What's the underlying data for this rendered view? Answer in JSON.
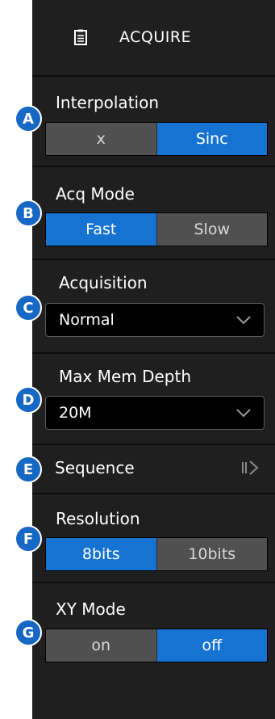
{
  "header": {
    "title": "ACQUIRE",
    "icon": "memo-icon"
  },
  "interpolation": {
    "label": "Interpolation",
    "options": [
      "x",
      "Sinc"
    ],
    "selected": "Sinc"
  },
  "acq_mode": {
    "label": "Acq Mode",
    "options": [
      "Fast",
      "Slow"
    ],
    "selected": "Fast"
  },
  "acquisition": {
    "label": "Acquisition",
    "value": "Normal"
  },
  "max_mem_depth": {
    "label": "Max Mem Depth",
    "value": "20M"
  },
  "sequence": {
    "label": "Sequence"
  },
  "resolution": {
    "label": "Resolution",
    "options": [
      "8bits",
      "10bits"
    ],
    "selected": "8bits"
  },
  "xy_mode": {
    "label": "XY Mode",
    "options": [
      "on",
      "off"
    ],
    "selected": "off"
  },
  "callouts": [
    "A",
    "B",
    "C",
    "D",
    "E",
    "F",
    "G"
  ],
  "colors": {
    "panel": "#1f1f1f",
    "active": "#1673d1",
    "inactive": "#505050",
    "badge": "#1668c4"
  }
}
